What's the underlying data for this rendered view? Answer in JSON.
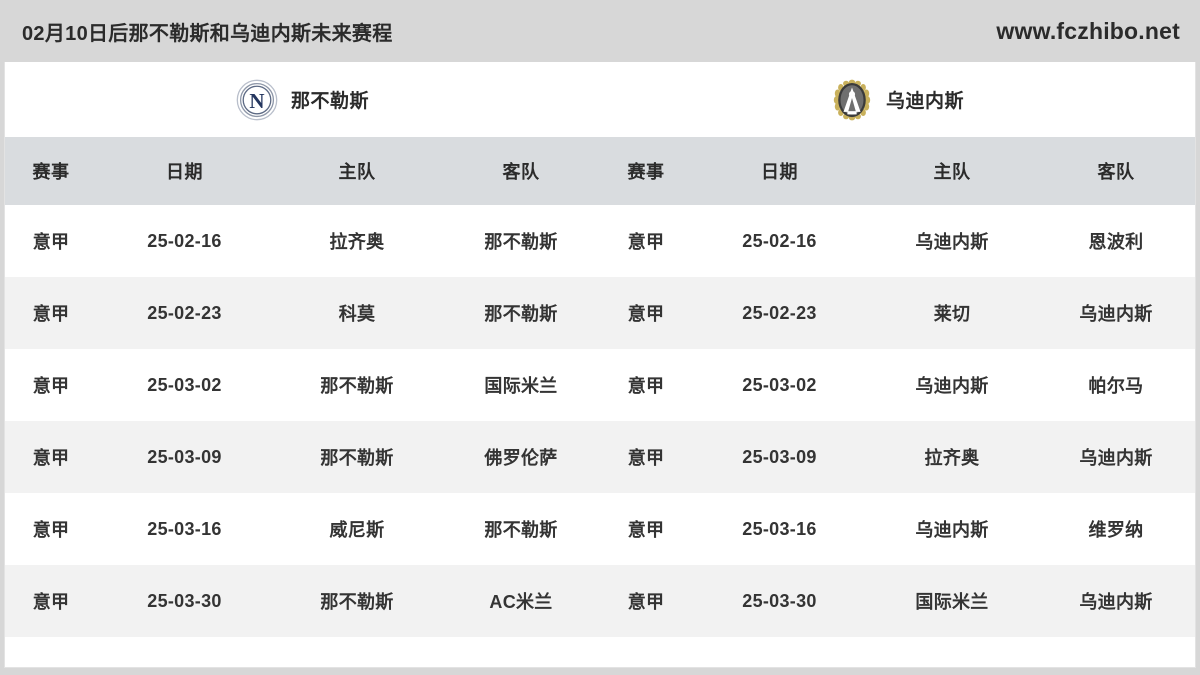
{
  "header": {
    "title": "02月10日后那不勒斯和乌迪内斯未来赛程",
    "site": "www.fczhibo.net"
  },
  "teams": {
    "left": {
      "name": "那不勒斯",
      "logo": "napoli-crest-icon"
    },
    "right": {
      "name": "乌迪内斯",
      "logo": "udinese-crest-icon"
    }
  },
  "columns": {
    "competition": "赛事",
    "date": "日期",
    "home": "主队",
    "away": "客队"
  },
  "rows": [
    {
      "l_comp": "意甲",
      "l_date": "25-02-16",
      "l_home": "拉齐奥",
      "l_away": "那不勒斯",
      "r_comp": "意甲",
      "r_date": "25-02-16",
      "r_home": "乌迪内斯",
      "r_away": "恩波利"
    },
    {
      "l_comp": "意甲",
      "l_date": "25-02-23",
      "l_home": "科莫",
      "l_away": "那不勒斯",
      "r_comp": "意甲",
      "r_date": "25-02-23",
      "r_home": "莱切",
      "r_away": "乌迪内斯"
    },
    {
      "l_comp": "意甲",
      "l_date": "25-03-02",
      "l_home": "那不勒斯",
      "l_away": "国际米兰",
      "r_comp": "意甲",
      "r_date": "25-03-02",
      "r_home": "乌迪内斯",
      "r_away": "帕尔马"
    },
    {
      "l_comp": "意甲",
      "l_date": "25-03-09",
      "l_home": "那不勒斯",
      "l_away": "佛罗伦萨",
      "r_comp": "意甲",
      "r_date": "25-03-09",
      "r_home": "拉齐奥",
      "r_away": "乌迪内斯"
    },
    {
      "l_comp": "意甲",
      "l_date": "25-03-16",
      "l_home": "威尼斯",
      "l_away": "那不勒斯",
      "r_comp": "意甲",
      "r_date": "25-03-16",
      "r_home": "乌迪内斯",
      "r_away": "维罗纳"
    },
    {
      "l_comp": "意甲",
      "l_date": "25-03-30",
      "l_home": "那不勒斯",
      "l_away": "AC米兰",
      "r_comp": "意甲",
      "r_date": "25-03-30",
      "r_home": "国际米兰",
      "r_away": "乌迪内斯"
    }
  ],
  "colors": {
    "page_background": "#d7d7d7",
    "card_background": "#ffffff",
    "header_row": "#d9dcdf",
    "row_alt": "#f2f2f2",
    "text": "#2b2b2b",
    "napoli_navy": "#1e3a6e",
    "udinese_dark": "#3a3a3a",
    "udinese_gold": "#c9b15c"
  }
}
